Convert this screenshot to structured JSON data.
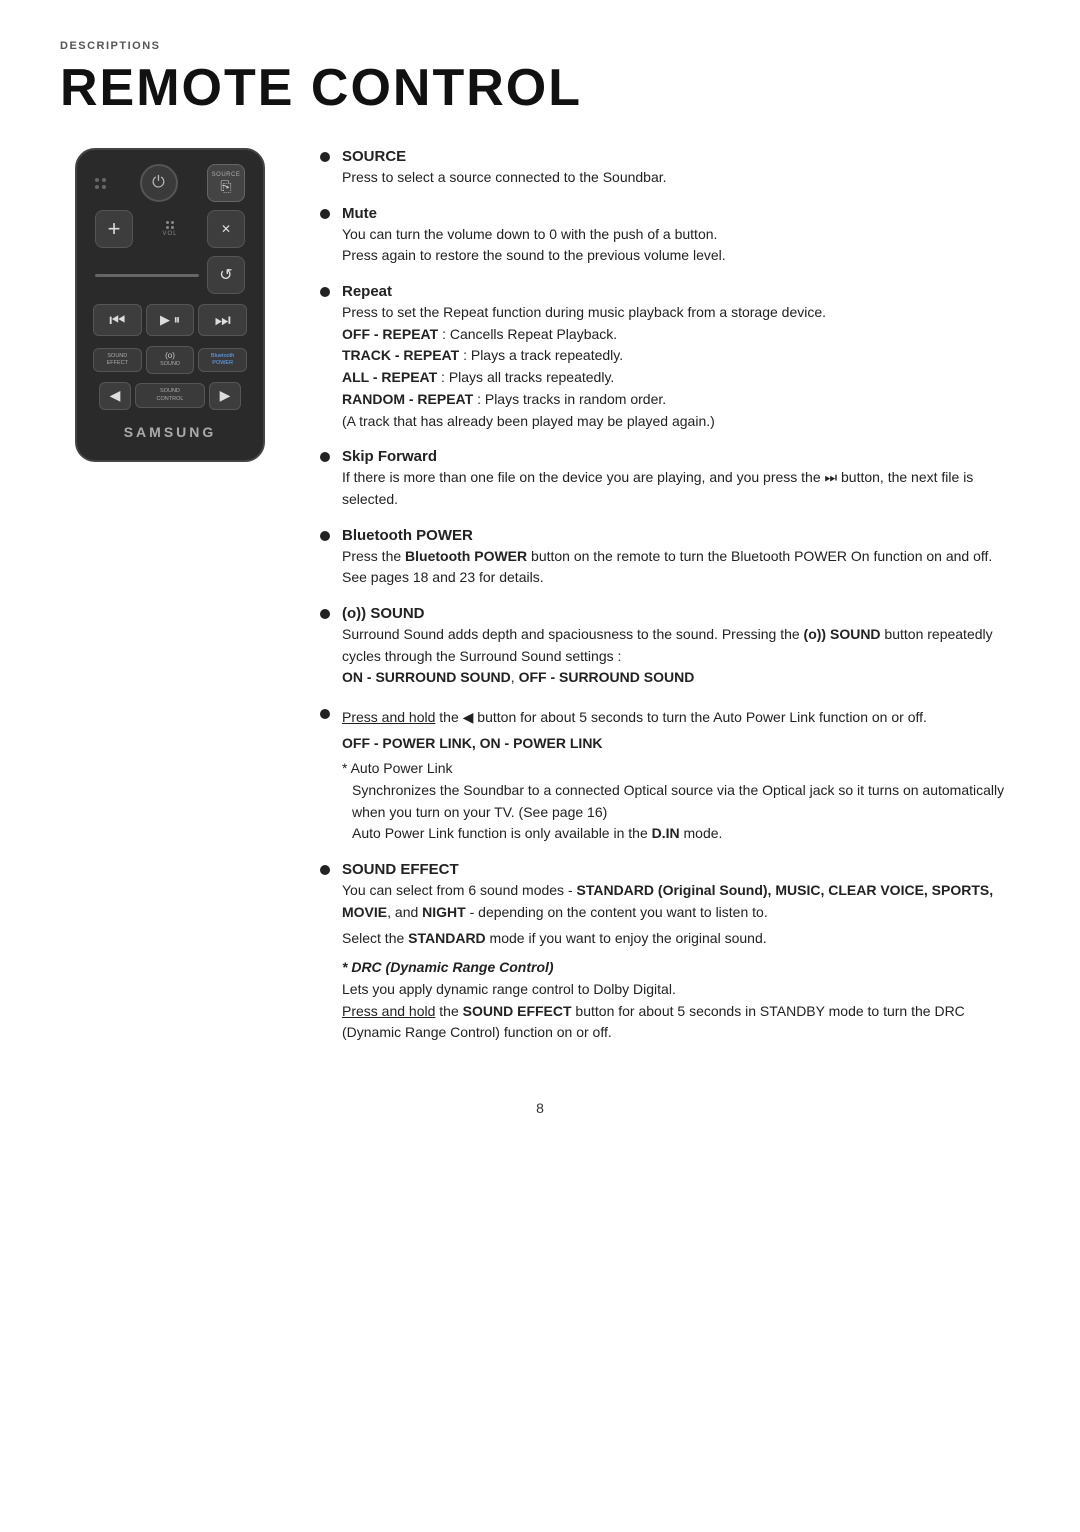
{
  "page": {
    "section_label": "DESCRIPTIONS",
    "title": "REMOTE CONTROL",
    "page_number": "8"
  },
  "remote": {
    "samsung_logo": "SAMSUNG",
    "buttons": {
      "power_icon": "⏻",
      "source_label": "SOURCE",
      "plus_icon": "+",
      "mute_icon": "🔇",
      "vol_label": "VOL",
      "repeat_icon": "↺",
      "prev_icon": "⏮",
      "play_icon": "▶⏸",
      "next_icon": "⏭",
      "sound_effect_label": "SOUND\nEFFECT",
      "surround_label": "(o)\nSOUND",
      "bluetooth_label": "Bluetooth\nPOWER",
      "left_arrow": "◀",
      "sound_control_label": "SOUND\nCONTROL",
      "right_arrow": "▶"
    }
  },
  "descriptions": [
    {
      "id": "source",
      "title": "SOURCE",
      "title_bold": true,
      "body": "Press to select a source connected to the Soundbar."
    },
    {
      "id": "mute",
      "title": "Mute",
      "title_bold": true,
      "body": "You can turn the volume down to 0 with the push of a button.\nPress again to restore the sound to the previous volume level."
    },
    {
      "id": "repeat",
      "title": "Repeat",
      "title_bold": true,
      "body_lines": [
        "Press to set the Repeat function during music playback from a storage device.",
        "OFF - REPEAT : Cancells Repeat Playback.",
        "TRACK - REPEAT : Plays a track repeatedly.",
        "ALL - REPEAT : Plays all tracks repeatedly.",
        "RANDOM - REPEAT : Plays tracks in random order.",
        "(A track that has already been played may be played again.)"
      ]
    },
    {
      "id": "skip-forward",
      "title": "Skip Forward",
      "title_bold": true,
      "body": "If there is more than one file on the device you are playing, and you press\nthe ⏭ button, the next file is selected."
    },
    {
      "id": "bluetooth-power",
      "title": "Bluetooth POWER",
      "title_bold": true,
      "body": "Press the Bluetooth POWER button on the remote to turn the Bluetooth\nPOWER On function on and off. See pages 18 and 23 for details."
    },
    {
      "id": "surround-sound",
      "title": "(o)) SOUND",
      "title_bold": true,
      "body_lines": [
        "Surround Sound adds depth and spaciousness to the sound. Pressing the",
        "(o)) SOUND button repeatedly cycles through the Surround Sound settings :",
        "ON - SURROUND SOUND, OFF - SURROUND SOUND"
      ]
    },
    {
      "id": "auto-power-link",
      "title": "",
      "title_bold": false,
      "body_lines": [
        "Press and hold the ◀ button for about 5 seconds to turn the Auto Power Link function on or off.",
        "OFF - POWER LINK, ON - POWER LINK",
        "* Auto Power Link",
        "Synchronizes the Soundbar to a connected Optical source via the Optical jack so it turns on automatically when you turn on your TV. (See page 16)",
        "Auto Power Link function is only available in the D.IN mode."
      ]
    },
    {
      "id": "sound-effect",
      "title": "SOUND EFFECT",
      "title_bold": true,
      "body_lines": [
        "You can select from 6 sound modes - STANDARD (Original Sound), MUSIC, CLEAR VOICE, SPORTS, MOVIE, and NIGHT - depending on the content you want to listen to.",
        "Select the STANDARD mode if you want to enjoy the original sound.",
        "* DRC (Dynamic Range Control)",
        "Lets you apply dynamic range control to Dolby Digital.",
        "Press and hold the SOUND EFFECT button for about 5 seconds in STANDBY mode to turn the DRC (Dynamic Range Control) function on or off."
      ]
    }
  ]
}
